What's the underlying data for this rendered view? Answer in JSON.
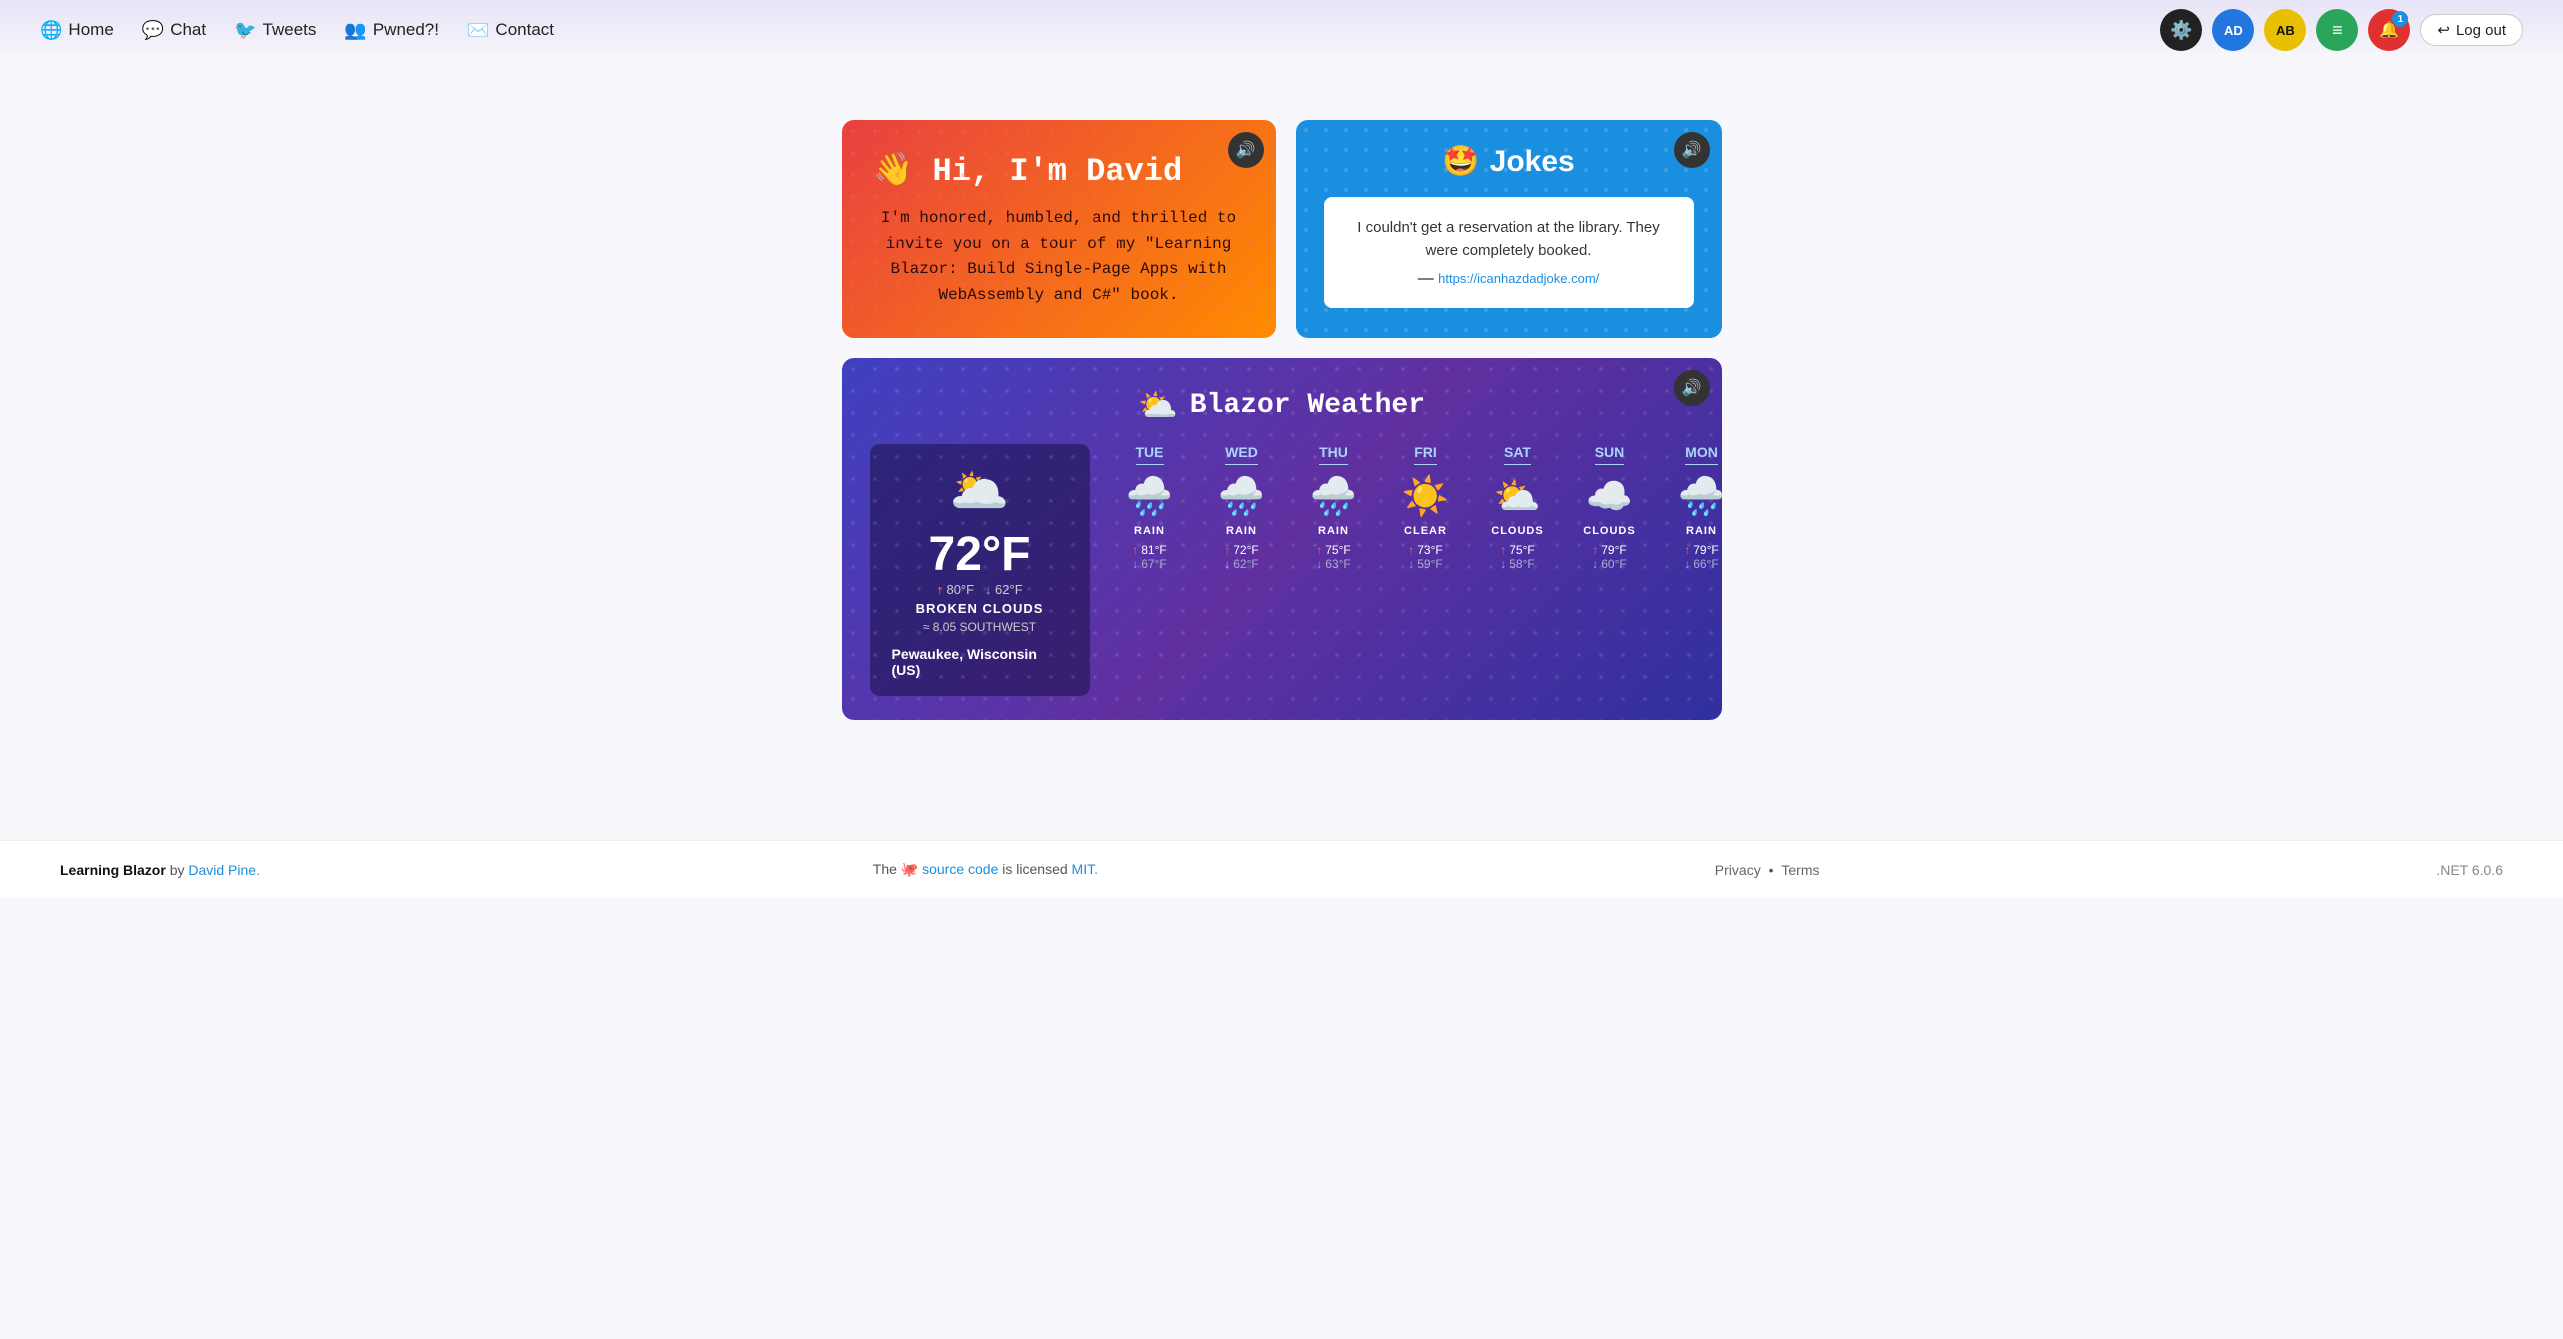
{
  "nav": {
    "home_label": "Home",
    "chat_label": "Chat",
    "tweets_label": "Tweets",
    "pwned_label": "Pwned?!",
    "contact_label": "Contact",
    "logout_label": "Log out"
  },
  "hi_card": {
    "title": "👋 Hi, I'm David",
    "text": "I'm honored, humbled, and thrilled to invite you on a tour of my \"Learning Blazor: Build Single-Page Apps with WebAssembly and C#\" book.",
    "sound_icon": "🔊"
  },
  "jokes_card": {
    "title": "Jokes",
    "emoji": "🤩",
    "joke_text": "I couldn't get a reservation at the library. They were completely booked.",
    "joke_attribution": "— https://icanhazdadjoke.com/",
    "joke_link": "https://icanhazdadjoke.com/",
    "sound_icon": "🔊"
  },
  "weather_card": {
    "title": "Blazor Weather",
    "emoji": "⛅",
    "sound_icon": "🔊",
    "current": {
      "temp": "72°F",
      "high": "80°F",
      "low": "62°F",
      "description": "BROKEN CLOUDS",
      "wind": "8.05 SOUTHWEST",
      "location": "Pewaukee, Wisconsin (US)"
    },
    "forecast": [
      {
        "day": "TUE",
        "icon": "🌧️",
        "condition": "RAIN",
        "high": "81°F",
        "low": "67°F"
      },
      {
        "day": "WED",
        "icon": "🌧️",
        "condition": "RAIN",
        "high": "72°F",
        "low": "62°F"
      },
      {
        "day": "THU",
        "icon": "🌧️",
        "condition": "RAIN",
        "high": "75°F",
        "low": "63°F"
      },
      {
        "day": "FRI",
        "icon": "☀️",
        "condition": "CLEAR",
        "high": "73°F",
        "low": "59°F"
      },
      {
        "day": "SAT",
        "icon": "⛅",
        "condition": "CLOUDS",
        "high": "75°F",
        "low": "58°F"
      },
      {
        "day": "SUN",
        "icon": "☁️",
        "condition": "CLOUDS",
        "high": "79°F",
        "low": "60°F"
      },
      {
        "day": "MON",
        "icon": "🌧️",
        "condition": "RAIN",
        "high": "79°F",
        "low": "66°F"
      }
    ]
  },
  "footer": {
    "brand": "Learning Blazor",
    "author": "David Pine.",
    "source_text": "The",
    "source_link_text": "source code",
    "source_link": "#",
    "license_text": "is licensed",
    "license_link_text": "MIT.",
    "license_link": "#",
    "privacy_label": "Privacy",
    "terms_label": "Terms",
    "version": ".NET 6.0.6"
  }
}
